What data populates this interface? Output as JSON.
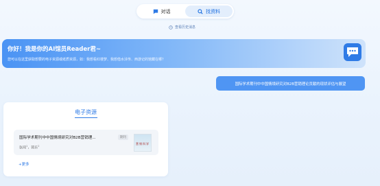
{
  "tabs": [
    {
      "label": "对话",
      "icon": "chat-icon",
      "active": false
    },
    {
      "label": "找资料",
      "icon": "search-icon",
      "active": true
    }
  ],
  "history_link": "查看历史消息",
  "banner": {
    "title": "你好！我是你的AI馆员Reader君~",
    "subtitle": "您可以在这里获取想要的电子资源或纸质资源，如：我想看红楼梦、我想借水浒传、西游记的馆藏在哪？",
    "icon": "chat-bubble-icon"
  },
  "user_message": "国际学术期刊中中国情境研究对B2B营销理论贡献的现状评估与展望",
  "resource_card": {
    "title": "电子资源",
    "item": {
      "title": "国际学术期刊中中国情境研究对B2B营销理...",
      "badge": "期刊",
      "author1": "张闯",
      "author1_sup": "1",
      "separator": "，",
      "author2": "郭乐",
      "author2_sup": "2",
      "thumb_text": "营销科学"
    },
    "more": "+更多"
  },
  "colors": {
    "accent": "#2f7be6",
    "banner_start": "#4a93f4",
    "user_bubble": "#4f95f3"
  }
}
